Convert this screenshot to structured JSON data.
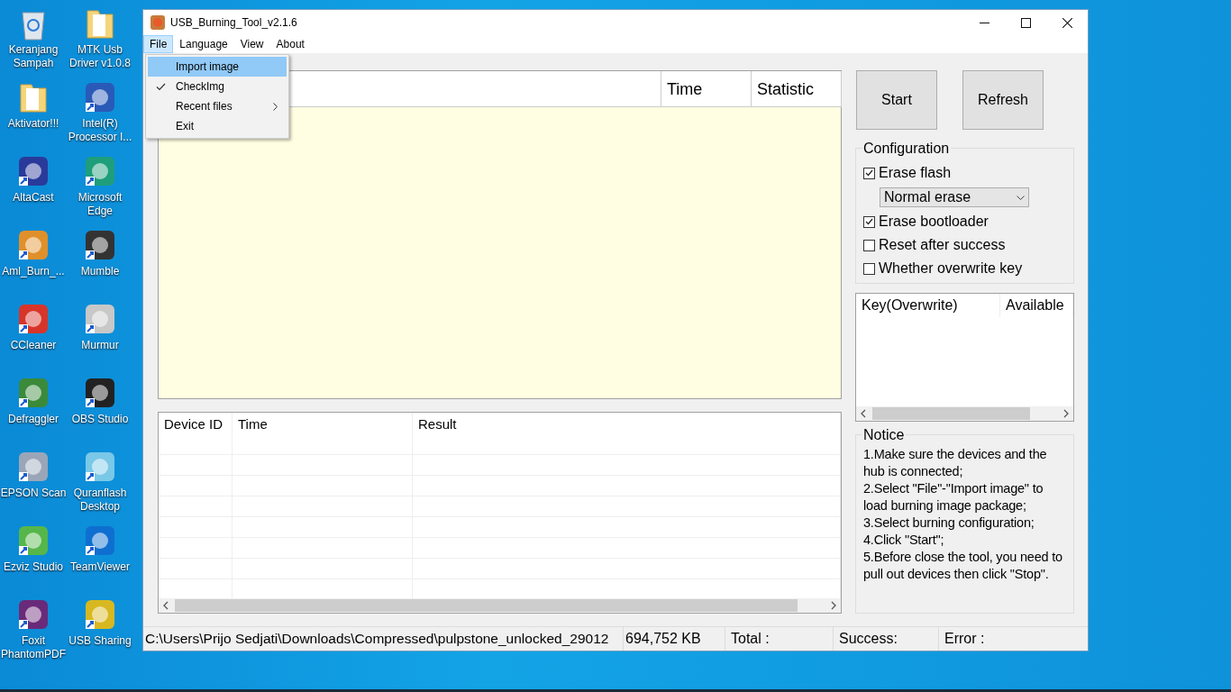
{
  "desktop": {
    "icons": [
      {
        "label": "Keranjang Sampah",
        "kind": "recycle",
        "color": "#dfe6ee"
      },
      {
        "label": "Aktivator!!!",
        "kind": "folder",
        "color": "#f5d57a"
      },
      {
        "label": "AltaCast",
        "kind": "app",
        "color": "#2a3a9a"
      },
      {
        "label": "Aml_Burn_...",
        "kind": "app",
        "color": "#e0902a"
      },
      {
        "label": "CCleaner",
        "kind": "app",
        "color": "#d8352a"
      },
      {
        "label": "Defraggler",
        "kind": "app",
        "color": "#3a8a3a"
      },
      {
        "label": "EPSON Scan",
        "kind": "app",
        "color": "#9aa6b8"
      },
      {
        "label": "Ezviz Studio",
        "kind": "app",
        "color": "#56b64a"
      },
      {
        "label": "Foxit PhantomPDF",
        "kind": "app",
        "color": "#6a2a7a"
      },
      {
        "label": "MTK Usb Driver v1.0.8",
        "kind": "folder",
        "color": "#f5d57a"
      },
      {
        "label": "Intel(R) Processor I...",
        "kind": "app",
        "color": "#2a5ab8"
      },
      {
        "label": "Microsoft Edge",
        "kind": "app",
        "color": "#1e9e7a"
      },
      {
        "label": "Mumble",
        "kind": "app",
        "color": "#333333"
      },
      {
        "label": "Murmur",
        "kind": "app",
        "color": "#c8c8c8"
      },
      {
        "label": "OBS Studio",
        "kind": "app",
        "color": "#222222"
      },
      {
        "label": "Quranflash Desktop",
        "kind": "app",
        "color": "#7ac8e8"
      },
      {
        "label": "TeamViewer",
        "kind": "app",
        "color": "#0e6fd0"
      },
      {
        "label": "USB Sharing",
        "kind": "app",
        "color": "#d8b820"
      }
    ]
  },
  "window": {
    "title": "USB_Burning_Tool_v2.1.6",
    "menu": [
      {
        "label": "File",
        "selected": true
      },
      {
        "label": "Language",
        "selected": false
      },
      {
        "label": "View",
        "selected": false
      },
      {
        "label": "About",
        "selected": false
      }
    ],
    "file_menu": [
      {
        "label": "Import image",
        "selected": true,
        "checked": false,
        "has_submenu": false
      },
      {
        "label": "CheckImg",
        "selected": false,
        "checked": true,
        "has_submenu": false
      },
      {
        "label": "Recent files",
        "selected": false,
        "checked": false,
        "has_submenu": true
      },
      {
        "label": "Exit",
        "selected": false,
        "checked": false,
        "has_submenu": false
      }
    ],
    "device_status_table": {
      "columns": [
        "Time",
        "Statistic"
      ]
    },
    "results_table": {
      "columns": [
        "Device ID",
        "Time",
        "Result"
      ]
    },
    "buttons": [
      "Start",
      "Refresh"
    ],
    "configuration": {
      "title": "Configuration",
      "options": [
        {
          "kind": "checkbox",
          "label": "Erase flash",
          "checked": true
        },
        {
          "kind": "dropdown",
          "value": "Normal erase"
        },
        {
          "kind": "checkbox",
          "label": "Erase bootloader",
          "checked": true
        },
        {
          "kind": "checkbox",
          "label": "Reset after success",
          "checked": false
        },
        {
          "kind": "checkbox",
          "label": "Whether overwrite key",
          "checked": false
        }
      ]
    },
    "key_table": {
      "columns": [
        "Key(Overwrite)",
        "Available"
      ]
    },
    "notice": {
      "title": "Notice",
      "lines": [
        "1.Make sure the devices and the hub is connected;",
        "2.Select \"File\"-\"Import image\" to load burning image package;",
        "3.Select burning configuration;",
        "4.Click \"Start\";",
        "5.Before close the tool, you need to pull out devices then click \"Stop\"."
      ]
    },
    "status_bar": {
      "path": "C:\\Users\\Prijo Sedjati\\Downloads\\Compressed\\pulpstone_unlocked_29012",
      "size": "694,752 KB",
      "total": "Total :",
      "success": "Success:",
      "error": "Error :"
    }
  }
}
